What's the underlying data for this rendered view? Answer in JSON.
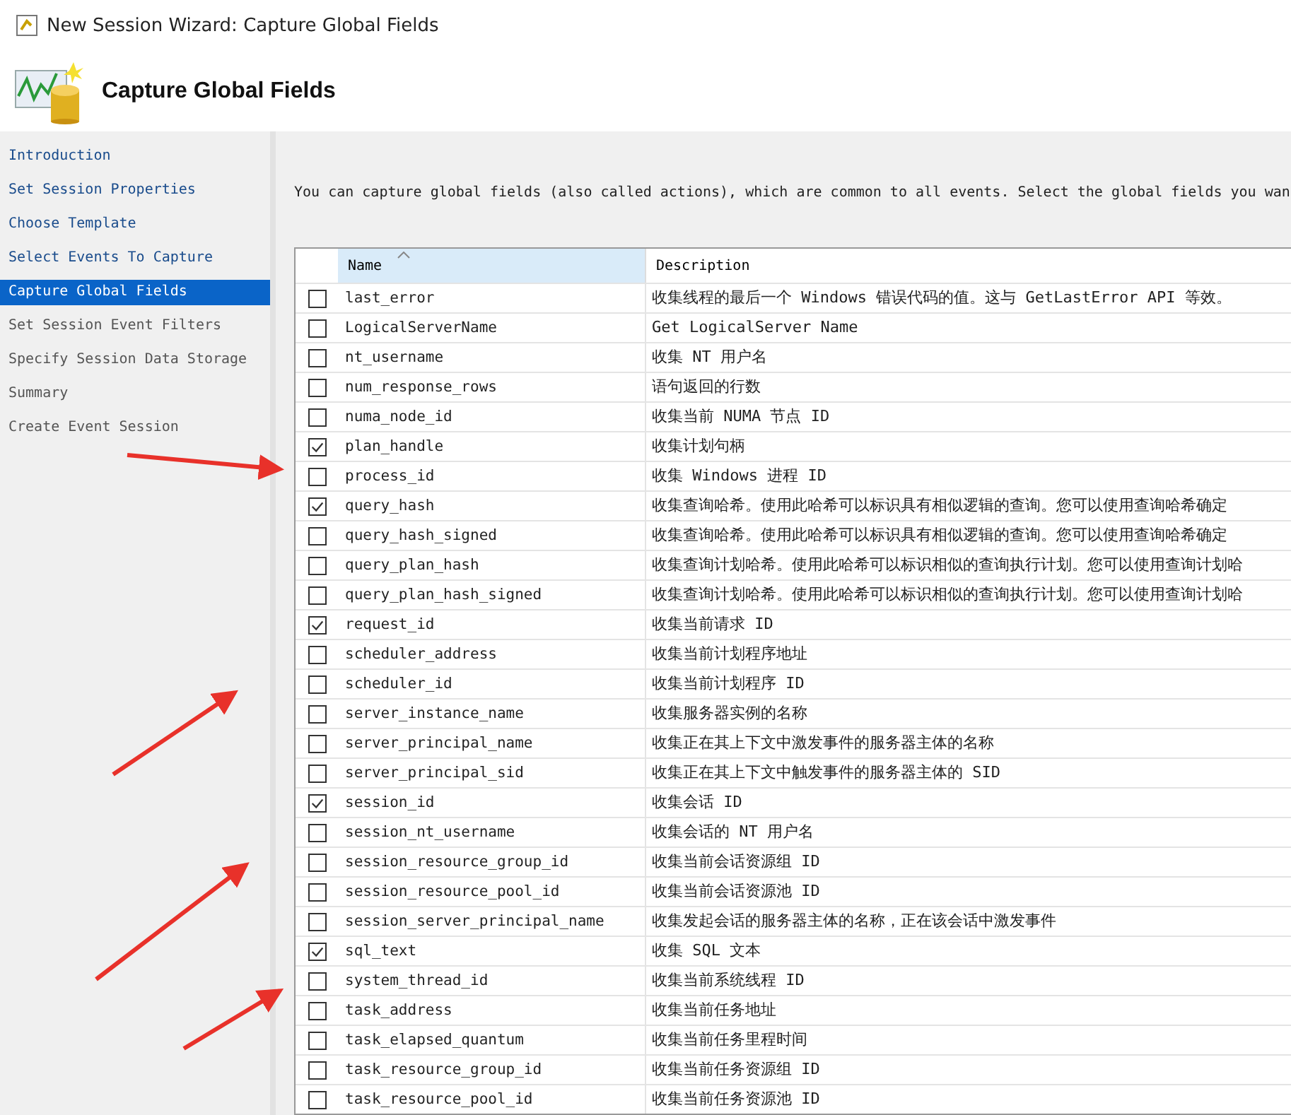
{
  "window": {
    "title": "New Session Wizard: Capture Global Fields"
  },
  "header": {
    "title": "Capture Global Fields"
  },
  "sidebar": {
    "items": [
      {
        "label": "Introduction",
        "selected": false,
        "visited": true
      },
      {
        "label": "Set Session Properties",
        "selected": false,
        "visited": true
      },
      {
        "label": "Choose Template",
        "selected": false,
        "visited": true
      },
      {
        "label": "Select Events To Capture",
        "selected": false,
        "visited": true
      },
      {
        "label": "Capture Global Fields",
        "selected": true,
        "visited": true
      },
      {
        "label": "Set Session Event Filters",
        "selected": false,
        "visited": false
      },
      {
        "label": "Specify Session Data Storage",
        "selected": false,
        "visited": false
      },
      {
        "label": "Summary",
        "selected": false,
        "visited": false
      },
      {
        "label": "Create Event Session",
        "selected": false,
        "visited": false
      }
    ]
  },
  "intro": "You can capture global fields (also called actions), which are common to all events. Select the global fields you wan",
  "table": {
    "columns": [
      "Name",
      "Description"
    ],
    "rows": [
      {
        "name": "last_error",
        "description": "收集线程的最后一个 Windows 错误代码的值。这与 GetLastError API 等效。",
        "checked": false
      },
      {
        "name": "LogicalServerName",
        "description": "Get LogicalServer Name",
        "checked": false
      },
      {
        "name": "nt_username",
        "description": "收集 NT 用户名",
        "checked": false
      },
      {
        "name": "num_response_rows",
        "description": "语句返回的行数",
        "checked": false
      },
      {
        "name": "numa_node_id",
        "description": "收集当前 NUMA 节点 ID",
        "checked": false
      },
      {
        "name": "plan_handle",
        "description": "收集计划句柄",
        "checked": true
      },
      {
        "name": "process_id",
        "description": "收集 Windows 进程 ID",
        "checked": false
      },
      {
        "name": "query_hash",
        "description": "收集查询哈希。使用此哈希可以标识具有相似逻辑的查询。您可以使用查询哈希确定",
        "checked": true
      },
      {
        "name": "query_hash_signed",
        "description": "收集查询哈希。使用此哈希可以标识具有相似逻辑的查询。您可以使用查询哈希确定",
        "checked": false
      },
      {
        "name": "query_plan_hash",
        "description": "收集查询计划哈希。使用此哈希可以标识相似的查询执行计划。您可以使用查询计划哈",
        "checked": false
      },
      {
        "name": "query_plan_hash_signed",
        "description": "收集查询计划哈希。使用此哈希可以标识相似的查询执行计划。您可以使用查询计划哈",
        "checked": false
      },
      {
        "name": "request_id",
        "description": "收集当前请求 ID",
        "checked": true
      },
      {
        "name": "scheduler_address",
        "description": "收集当前计划程序地址",
        "checked": false
      },
      {
        "name": "scheduler_id",
        "description": "收集当前计划程序 ID",
        "checked": false
      },
      {
        "name": "server_instance_name",
        "description": "收集服务器实例的名称",
        "checked": false
      },
      {
        "name": "server_principal_name",
        "description": "收集正在其上下文中激发事件的服务器主体的名称",
        "checked": false
      },
      {
        "name": "server_principal_sid",
        "description": "收集正在其上下文中触发事件的服务器主体的 SID",
        "checked": false
      },
      {
        "name": "session_id",
        "description": "收集会话 ID",
        "checked": true
      },
      {
        "name": "session_nt_username",
        "description": "收集会话的 NT 用户名",
        "checked": false
      },
      {
        "name": "session_resource_group_id",
        "description": "收集当前会话资源组 ID",
        "checked": false
      },
      {
        "name": "session_resource_pool_id",
        "description": "收集当前会话资源池 ID",
        "checked": false
      },
      {
        "name": "session_server_principal_name",
        "description": "收集发起会话的服务器主体的名称，正在该会话中激发事件",
        "checked": false
      },
      {
        "name": "sql_text",
        "description": "收集 SQL 文本",
        "checked": true
      },
      {
        "name": "system_thread_id",
        "description": "收集当前系统线程 ID",
        "checked": false
      },
      {
        "name": "task_address",
        "description": "收集当前任务地址",
        "checked": false
      },
      {
        "name": "task_elapsed_quantum",
        "description": "收集当前任务里程时间",
        "checked": false
      },
      {
        "name": "task_resource_group_id",
        "description": "收集当前任务资源组 ID",
        "checked": false
      },
      {
        "name": "task_resource_pool_id",
        "description": "收集当前任务资源池 ID",
        "checked": false
      }
    ]
  }
}
